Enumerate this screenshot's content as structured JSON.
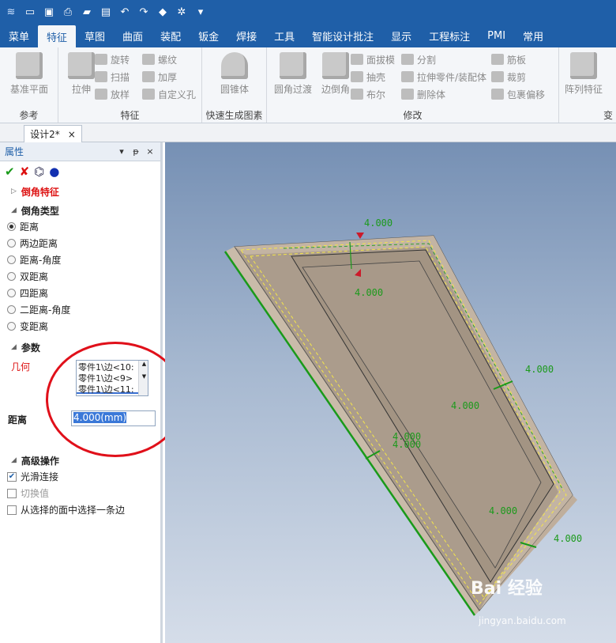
{
  "quick_access": {
    "icons": [
      "app-menu-icon",
      "new-file-icon",
      "open-file-icon",
      "print-icon",
      "folder-icon",
      "save-icon",
      "undo-icon",
      "redo-icon",
      "regen-icon",
      "options-icon",
      "dropdown-icon"
    ]
  },
  "ribbon_tabs": [
    "菜单",
    "特征",
    "草图",
    "曲面",
    "装配",
    "钣金",
    "焊接",
    "工具",
    "智能设计批注",
    "显示",
    "工程标注",
    "PMI",
    "常用"
  ],
  "active_tab": "特征",
  "ribbon": {
    "groups": [
      {
        "label": "参考",
        "big": [
          "基准平面"
        ]
      },
      {
        "label": "特征",
        "big": [
          "拉伸"
        ],
        "small": [
          "旋转",
          "扫描",
          "放样",
          "螺纹",
          "加厚",
          "自定义孔"
        ]
      },
      {
        "label": "快速生成图素",
        "big": [
          "圆锥体"
        ]
      },
      {
        "label": "修改",
        "big": [
          "圆角过渡",
          "边倒角"
        ],
        "small": [
          "面拔模",
          "抽壳",
          "布尔",
          "分割",
          "拉伸零件/装配体",
          "删除体",
          "筋板",
          "裁剪",
          "包裹偏移"
        ]
      },
      {
        "label": "变",
        "big": [
          "阵列特征"
        ]
      }
    ]
  },
  "document_tab": {
    "title": "设计2*",
    "close": "×"
  },
  "panel": {
    "title": "属性",
    "header_buttons": [
      "▾",
      "ᵽ",
      "×"
    ],
    "feature_title": "倒角特征",
    "chamfer_type_label": "倒角类型",
    "chamfer_types": [
      "距离",
      "两边距离",
      "距离-角度",
      "双距离",
      "四距离",
      "二距离-角度",
      "变距离"
    ],
    "selected_type": "距离",
    "params_label": "参数",
    "geometry_label": "几何",
    "geometry_items": [
      "零件1\\边<10:",
      "零件1\\边<9>",
      "零件1\\边<11:"
    ],
    "distance_label": "距离",
    "distance_value": "4.000(mm)",
    "advanced_label": "高级操作",
    "options": [
      {
        "label": "光滑连接",
        "checked": true,
        "disabled": false
      },
      {
        "label": "切换值",
        "checked": false,
        "disabled": true
      },
      {
        "label": "从选择的面中选择一条边",
        "checked": false,
        "disabled": false
      }
    ]
  },
  "viewport": {
    "dimension_labels": [
      "4.000",
      "4.000",
      "4.000",
      "4.000",
      "4.000",
      "4.000",
      "4.000",
      "4.000"
    ]
  },
  "watermark": {
    "brand": "Bai 经验",
    "url": "jingyan.baidu.com"
  },
  "colors": {
    "ribbon_blue": "#1f5fa8",
    "highlight_red": "#e0101a",
    "dimension_green": "#1c9a1c",
    "part_face": "#a89888"
  }
}
